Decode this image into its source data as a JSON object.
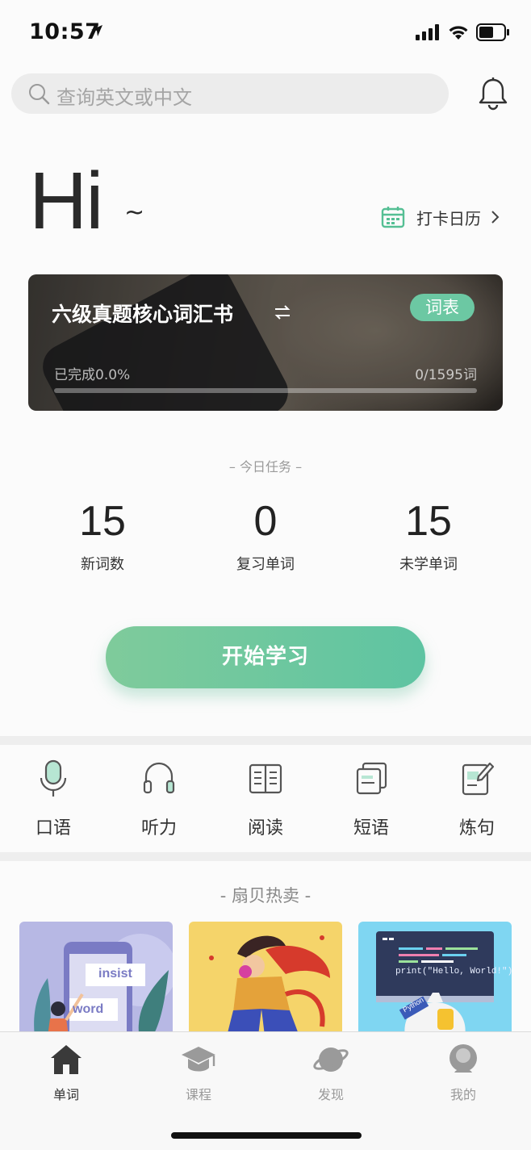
{
  "status_bar": {
    "time": "10:57"
  },
  "search": {
    "placeholder": "查询英文或中文"
  },
  "greeting": {
    "text": "Hi",
    "tilde": "~"
  },
  "calendar": {
    "label": "打卡日历"
  },
  "book": {
    "title": "六级真题核心词汇书",
    "badge": "词表",
    "progress_text": "已完成0.0%",
    "count_text": "0/1595词",
    "progress_percent": 0
  },
  "tasks": {
    "heading": "– 今日任务 –",
    "stats": [
      {
        "value": "15",
        "label": "新词数"
      },
      {
        "value": "0",
        "label": "复习单词"
      },
      {
        "value": "15",
        "label": "未学单词"
      }
    ]
  },
  "start_button": {
    "label": "开始学习"
  },
  "features": [
    {
      "label": "口语",
      "icon": "microphone-icon"
    },
    {
      "label": "听力",
      "icon": "headphones-icon"
    },
    {
      "label": "阅读",
      "icon": "book-open-icon"
    },
    {
      "label": "短语",
      "icon": "cards-icon"
    },
    {
      "label": "炼句",
      "icon": "edit-note-icon"
    }
  ],
  "hot": {
    "heading": "- 扇贝热卖 -",
    "cards": [
      {
        "words": [
          "insist",
          "word"
        ]
      },
      {
        "words": []
      },
      {
        "code": "print(\"Hello, World!\")",
        "tag": "Python"
      }
    ]
  },
  "tabs": [
    {
      "label": "单词",
      "icon": "home-icon",
      "active": true
    },
    {
      "label": "课程",
      "icon": "graduation-cap-icon",
      "active": false
    },
    {
      "label": "发现",
      "icon": "planet-icon",
      "active": false
    },
    {
      "label": "我的",
      "icon": "profile-icon",
      "active": false
    }
  ],
  "colors": {
    "accent": "#6cc8a3",
    "button_start": "#7fcb9b",
    "button_end": "#5ec4a2"
  }
}
